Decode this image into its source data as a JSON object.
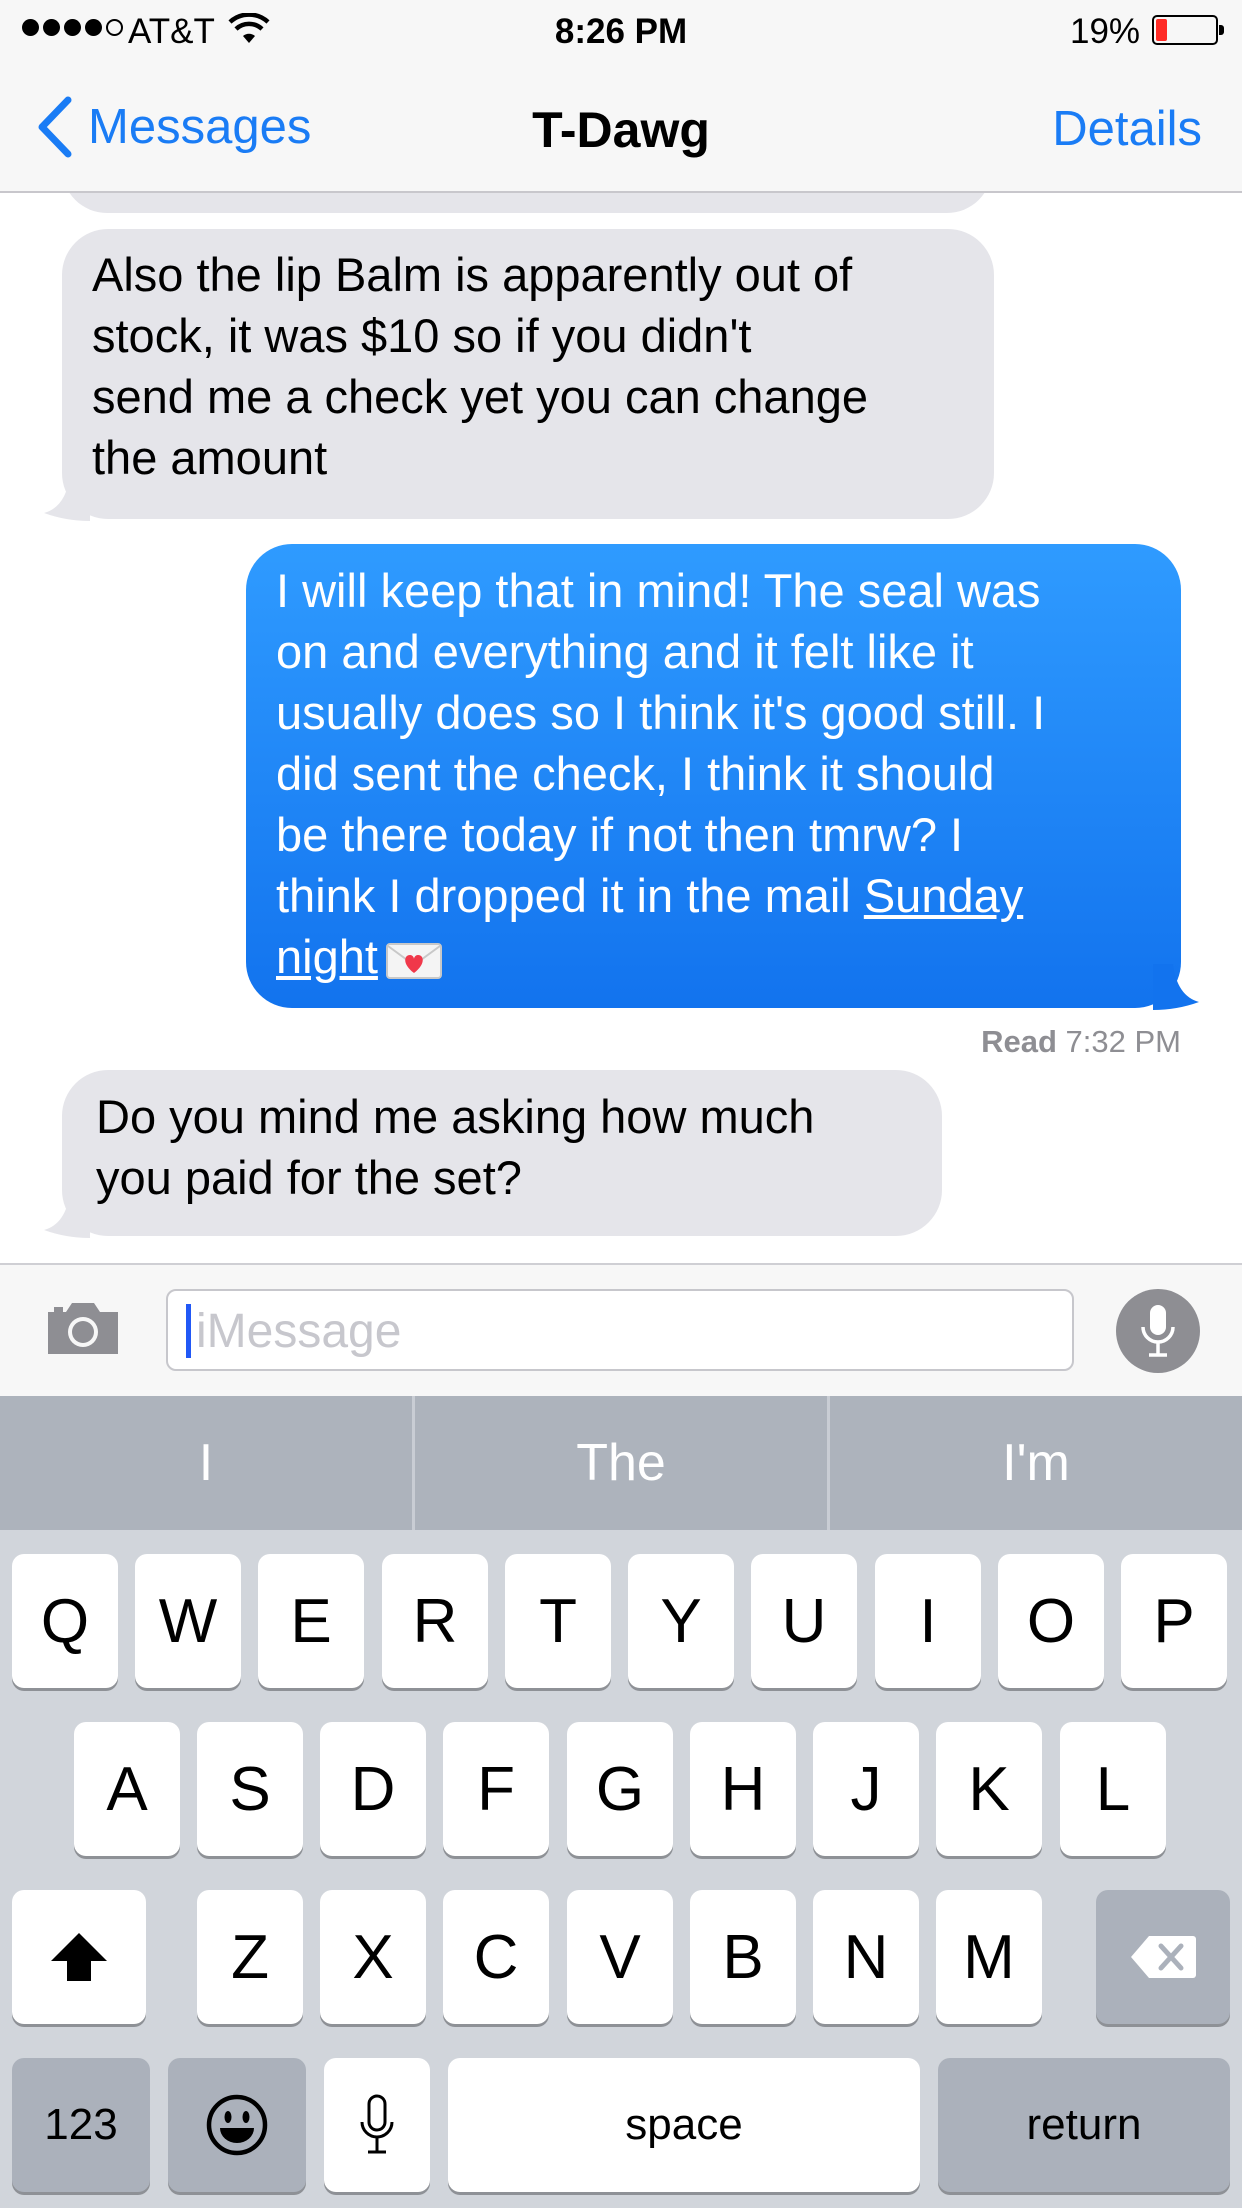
{
  "status_bar": {
    "carrier": "AT&T",
    "time": "8:26 PM",
    "battery_percent": "19%",
    "battery_level": 0.19,
    "signal_bars_filled": 4,
    "signal_bars_total": 5
  },
  "nav": {
    "back_label": "Messages",
    "title": "T-Dawg",
    "details_label": "Details"
  },
  "messages": [
    {
      "direction": "incoming",
      "text": "Also the lip Balm is apparently out of stock, it was $10 so if you didn't send me a check yet you can change the amount",
      "lines": [
        "Also the lip Balm is apparently out of",
        "stock, it was $10 so if you didn't",
        "send me a check yet you can change",
        "the amount"
      ]
    },
    {
      "direction": "outgoing",
      "lines": [
        "I will keep that in mind! The seal was",
        "on and everything and it felt like it",
        "usually does so I think it's good still. I",
        "did sent the check, I think it should",
        "be there today if not then tmrw? I",
        "think I dropped it in the mail "
      ],
      "link_part1": "Sunday",
      "link_part2": "night",
      "emoji": "love-letter-emoji"
    },
    {
      "direction": "incoming",
      "lines": [
        "Do you mind me asking how much",
        "you paid for the set?"
      ]
    }
  ],
  "read_receipt": {
    "label": "Read",
    "time": "7:32 PM"
  },
  "input": {
    "placeholder": "iMessage",
    "value": ""
  },
  "predictions": [
    "I",
    "The",
    "I'm"
  ],
  "keyboard": {
    "row1": [
      "Q",
      "W",
      "E",
      "R",
      "T",
      "Y",
      "U",
      "I",
      "O",
      "P"
    ],
    "row2": [
      "A",
      "S",
      "D",
      "F",
      "G",
      "H",
      "J",
      "K",
      "L"
    ],
    "row3": [
      "Z",
      "X",
      "C",
      "V",
      "B",
      "N",
      "M"
    ],
    "numbers_label": "123",
    "space_label": "space",
    "return_label": "return"
  },
  "colors": {
    "ios_blue": "#1a7cf5",
    "incoming_bubble": "#e5e5ea",
    "outgoing_bubble": "#1b82f5",
    "battery_low": "#ff2b26"
  },
  "icons": [
    "chevron-left-icon",
    "wifi-icon",
    "camera-icon",
    "microphone-icon",
    "shift-icon",
    "delete-icon",
    "emoji-icon",
    "dictation-icon"
  ]
}
